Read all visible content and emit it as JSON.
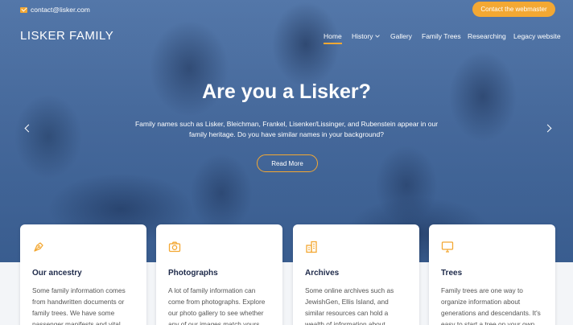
{
  "topbar": {
    "email": "contact@lisker.com",
    "email_icon": "mail-icon",
    "webmaster_label": "Contact the webmaster",
    "accent_color": "#f3a833"
  },
  "nav": {
    "brand": "LISKER FAMILY",
    "items": [
      {
        "label": "Home",
        "active": true
      },
      {
        "label": "History",
        "has_dropdown": true
      },
      {
        "label": "Gallery"
      },
      {
        "label": "Family Trees"
      },
      {
        "label": "Researching"
      },
      {
        "label": "Legacy website"
      }
    ]
  },
  "hero": {
    "title": "Are you a Lisker?",
    "subtitle": "Family names such as Lisker, Bleichman, Frankel, Lisenker/Lissinger, and Rubenstein appear in our family heritage. Do you have similar names in your background?",
    "button_label": "Read More",
    "background_tint": "#4d6f9f"
  },
  "cards": [
    {
      "icon": "pen-nib-icon",
      "title": "Our ancestry",
      "text": "Some family information comes from handwritten documents or family trees. We have some passenger manifests and vital"
    },
    {
      "icon": "camera-icon",
      "title": "Photographs",
      "text": "A lot of family information can come from photographs. Explore our photo gallery to see whether any of our images match yours."
    },
    {
      "icon": "archive-building-icon",
      "title": "Archives",
      "text": "Some online archives such as JewishGen, Ellis Island, and similar resources can hold a wealth of information about emigrating"
    },
    {
      "icon": "monitor-icon",
      "title": "Trees",
      "text": "Family trees are one way to organize information about generations and descendants. It's easy to start a tree on your own"
    }
  ]
}
